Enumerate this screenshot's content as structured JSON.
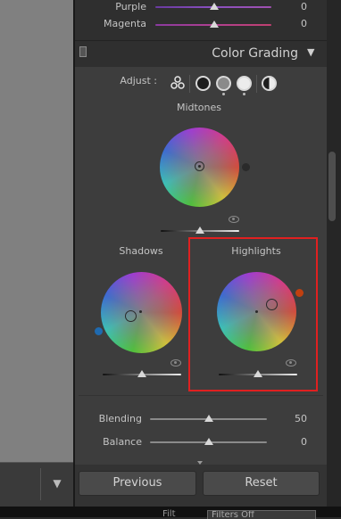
{
  "top_sliders": [
    {
      "label": "Purple",
      "value": "0",
      "position": 0.5
    },
    {
      "label": "Magenta",
      "value": "0",
      "position": 0.5
    }
  ],
  "section": {
    "title": "Color Grading",
    "collapse_glyph": "▼"
  },
  "adjust": {
    "label": "Adjust :",
    "modes": [
      "three-way-icon",
      "shadows-mode",
      "midtones-mode",
      "highlights-mode",
      "global-mode"
    ],
    "selected_mode": "three-way-icon"
  },
  "wheels": {
    "midtones": {
      "label": "Midtones",
      "luminance": 0.5
    },
    "shadows": {
      "label": "Shadows",
      "luminance": 0.5
    },
    "highlights": {
      "label": "Highlights",
      "luminance": 0.5
    }
  },
  "blending": {
    "label": "Blending",
    "value": "50",
    "position": 0.5
  },
  "balance": {
    "label": "Balance",
    "value": "0",
    "position": 0.5
  },
  "buttons": {
    "previous": "Previous",
    "reset": "Reset"
  },
  "filter": {
    "label": "Filt",
    "selected": "Filters Off"
  },
  "colors": {
    "highlight_box": "#e02020",
    "panel_bg": "#3d3d3d",
    "shadow_dot": "#1f6ab0",
    "highlight_dot": "#c04010",
    "midtone_dot": "#2a2a2a"
  }
}
